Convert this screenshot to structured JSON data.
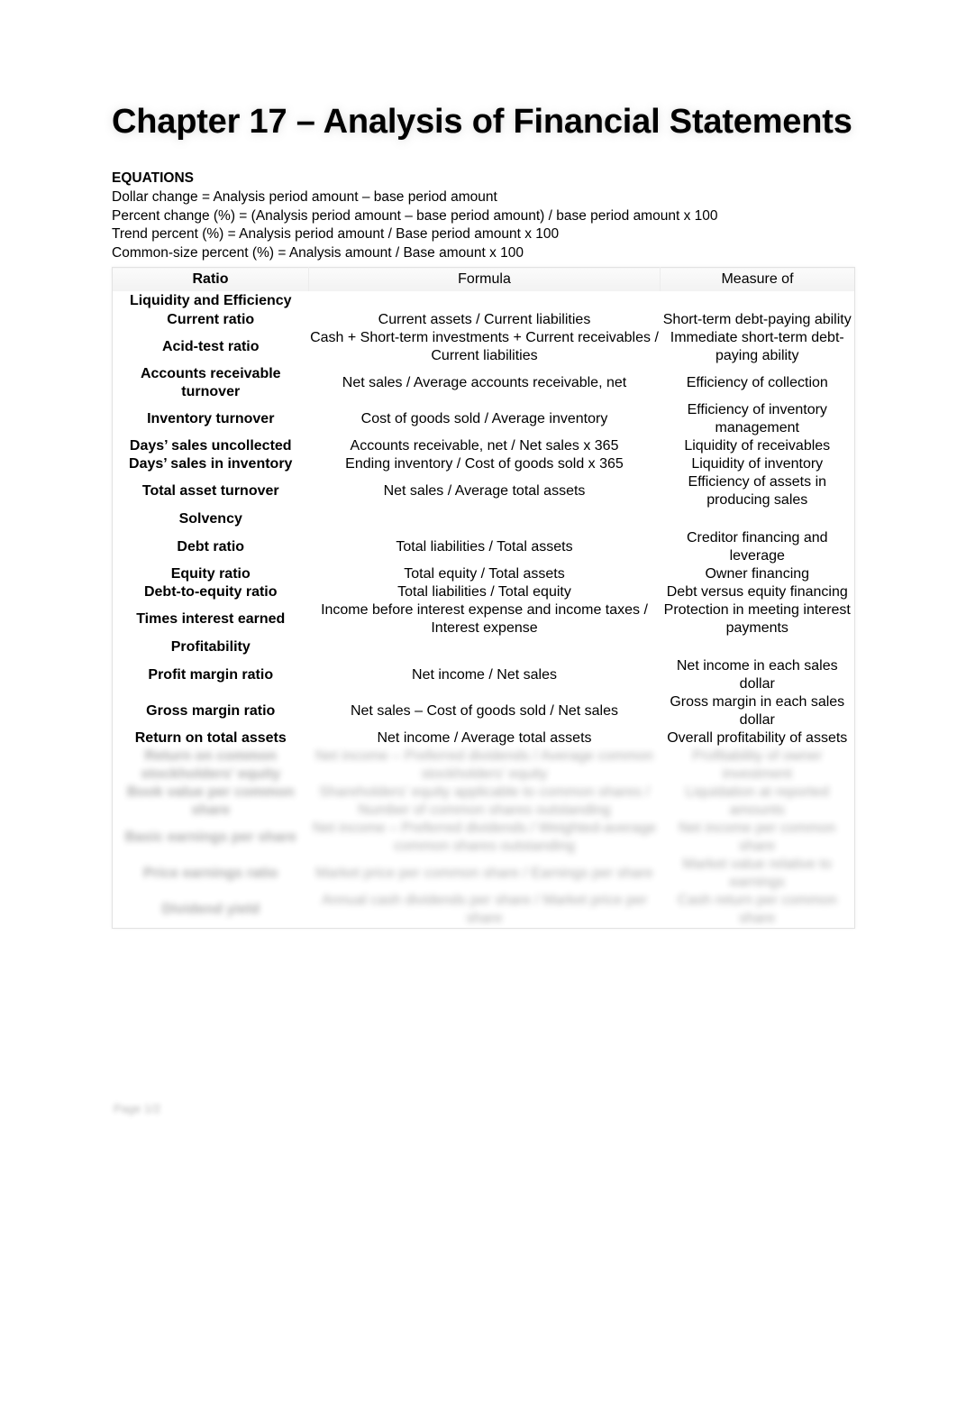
{
  "document": {
    "title": "Chapter 17 – Analysis of Financial Statements",
    "footer_text": "Page 1/2"
  },
  "equations": {
    "heading": "EQUATIONS",
    "lines": [
      "Dollar change = Analysis period amount – base period amount",
      "Percent change (%) = (Analysis period amount – base period amount) / base period amount x 100",
      "Trend percent (%) = Analysis period amount / Base period amount x 100",
      "Common-size percent (%) = Analysis amount / Base amount x 100"
    ]
  },
  "table": {
    "headers": {
      "ratio": "Ratio",
      "formula": "Formula",
      "measure": "Measure of"
    },
    "sections": [
      {
        "label": "Liquidity and Efficiency",
        "rows": [
          {
            "ratio": "Current ratio",
            "formula": "Current assets / Current liabilities",
            "measure": "Short-term debt-paying ability"
          },
          {
            "ratio": "Acid-test ratio",
            "formula": "Cash + Short-term investments + Current receivables / Current liabilities",
            "measure": "Immediate short-term debt-paying ability"
          },
          {
            "ratio": "Accounts receivable turnover",
            "formula": "Net sales / Average accounts receivable, net",
            "measure": "Efficiency of collection"
          },
          {
            "ratio": "Inventory turnover",
            "formula": "Cost of goods sold / Average inventory",
            "measure": "Efficiency of inventory management"
          },
          {
            "ratio": "Days’ sales uncollected",
            "formula": "Accounts receivable, net / Net sales x 365",
            "measure": "Liquidity of receivables"
          },
          {
            "ratio": "Days’ sales in inventory",
            "formula": "Ending inventory / Cost of goods sold x 365",
            "measure": "Liquidity of inventory"
          },
          {
            "ratio": "Total asset turnover",
            "formula": "Net sales / Average total assets",
            "measure": "Efficiency of assets in producing sales"
          }
        ]
      },
      {
        "label": "Solvency",
        "rows": [
          {
            "ratio": "Debt ratio",
            "formula": "Total liabilities / Total assets",
            "measure": "Creditor financing and leverage"
          },
          {
            "ratio": "Equity ratio",
            "formula": "Total equity / Total assets",
            "measure": "Owner financing"
          },
          {
            "ratio": "Debt-to-equity ratio",
            "formula": "Total liabilities / Total equity",
            "measure": "Debt versus equity financing"
          },
          {
            "ratio": "Times interest earned",
            "formula": "Income before interest expense and income taxes / Interest expense",
            "measure": "Protection in meeting interest payments"
          }
        ]
      },
      {
        "label": "Profitability",
        "rows": [
          {
            "ratio": "Profit margin ratio",
            "formula": "Net income / Net sales",
            "measure": "Net income in each sales dollar"
          },
          {
            "ratio": "Gross margin ratio",
            "formula": "Net sales – Cost of goods sold / Net sales",
            "measure": "Gross margin in each sales dollar"
          },
          {
            "ratio": "Return on total assets",
            "formula": "Net income / Average total assets",
            "measure": "Overall profitability of assets"
          }
        ]
      }
    ],
    "obscured_rows": [
      {
        "ratio": "Return on common stockholders’ equity",
        "formula": "Net income – Preferred dividends / Average common stockholders’ equity",
        "measure": "Profitability of owner investment"
      },
      {
        "ratio": "Book value per common share",
        "formula": "Shareholders’ equity applicable to common shares / Number of common shares outstanding",
        "measure": "Liquidation at reported amounts"
      },
      {
        "ratio": "Basic earnings per share",
        "formula": "Net income – Preferred dividends / Weighted-average common shares outstanding",
        "measure": "Net income per common share"
      },
      {
        "ratio": "Price earnings ratio",
        "formula": "Market price per common share / Earnings per share",
        "measure": "Market value relative to earnings"
      },
      {
        "ratio": "Dividend yield",
        "formula": "Annual cash dividends per share / Market price per share",
        "measure": "Cash return per common share"
      }
    ]
  }
}
